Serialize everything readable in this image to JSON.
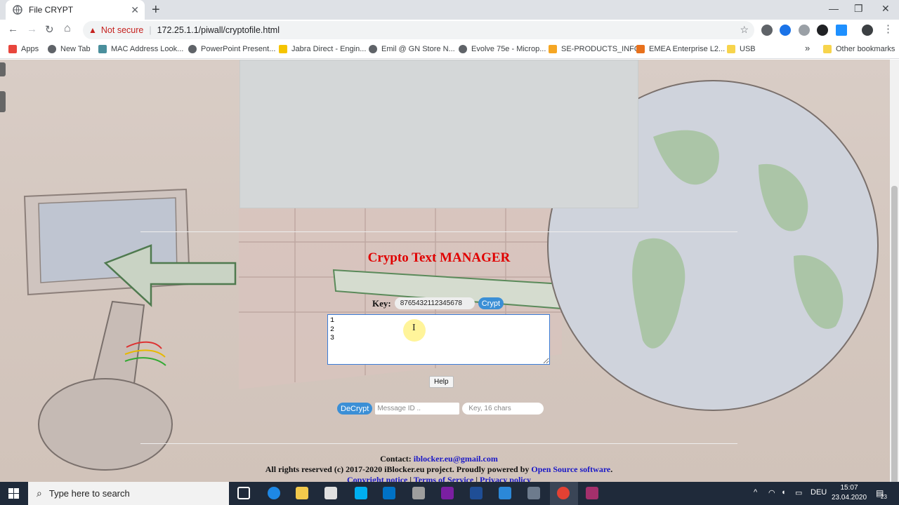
{
  "browser": {
    "tab_title": "File CRYPT",
    "tab_close": "✕",
    "new_tab": "+",
    "window_controls": {
      "minimize": "—",
      "maximize": "❐",
      "close": "✕"
    },
    "nav": {
      "back": "←",
      "forward": "→",
      "reload": "↻",
      "home": "⌂"
    },
    "security_text": "Not secure",
    "url": "172.25.1.1/piwall/cryptofile.html",
    "bookmark_star": "☆",
    "bookmarks": [
      {
        "label": "Apps",
        "color": "#e8453c"
      },
      {
        "label": "New Tab",
        "color": "#5f6368"
      },
      {
        "label": "MAC Address Look...",
        "color": "#4a8f9c"
      },
      {
        "label": "PowerPoint Present...",
        "color": "#5f6368"
      },
      {
        "label": "Jabra Direct - Engin...",
        "color": "#f5c400"
      },
      {
        "label": "Emil @ GN Store N...",
        "color": "#5f6368"
      },
      {
        "label": "Evolve 75e - Microp...",
        "color": "#5f6368"
      },
      {
        "label": "SE-PRODUCTS_INFO",
        "color": "#f5a623"
      },
      {
        "label": "EMEA Enterprise L2...",
        "color": "#e8711c"
      },
      {
        "label": "USB",
        "color": "#f7d44c"
      }
    ],
    "more_bookmarks": "»",
    "other_bookmarks": "Other bookmarks"
  },
  "page": {
    "title": "Crypto Text MANAGER",
    "key_label": "Key:",
    "key_value": "8765432112345678",
    "crypt_button": "Crypt",
    "textarea_value": "1\n2\n3\n",
    "help_button": "Help",
    "decrypt_button": "DeCrypt",
    "message_id_placeholder": "Message ID ..",
    "key16_placeholder": "Key, 16 chars",
    "footer": {
      "contact_label": "Contact:",
      "contact_email": "iblocker.eu@gmail.com",
      "rights_text": "All rights reserved (c) 2017-2020 iBlocker.eu project. Proudly powered by",
      "oss_link": "Open Source software",
      "period": ".",
      "copyright_link": "Copyright notice",
      "sep": "|",
      "tos_link": "Terms of Service",
      "privacy_link": "Privacy policy"
    }
  },
  "taskbar": {
    "search_placeholder": "Type here to search",
    "tray_chevron": "^",
    "language": "DEU",
    "time": "15:07",
    "date": "23.04.2020",
    "notification_count": "23"
  }
}
